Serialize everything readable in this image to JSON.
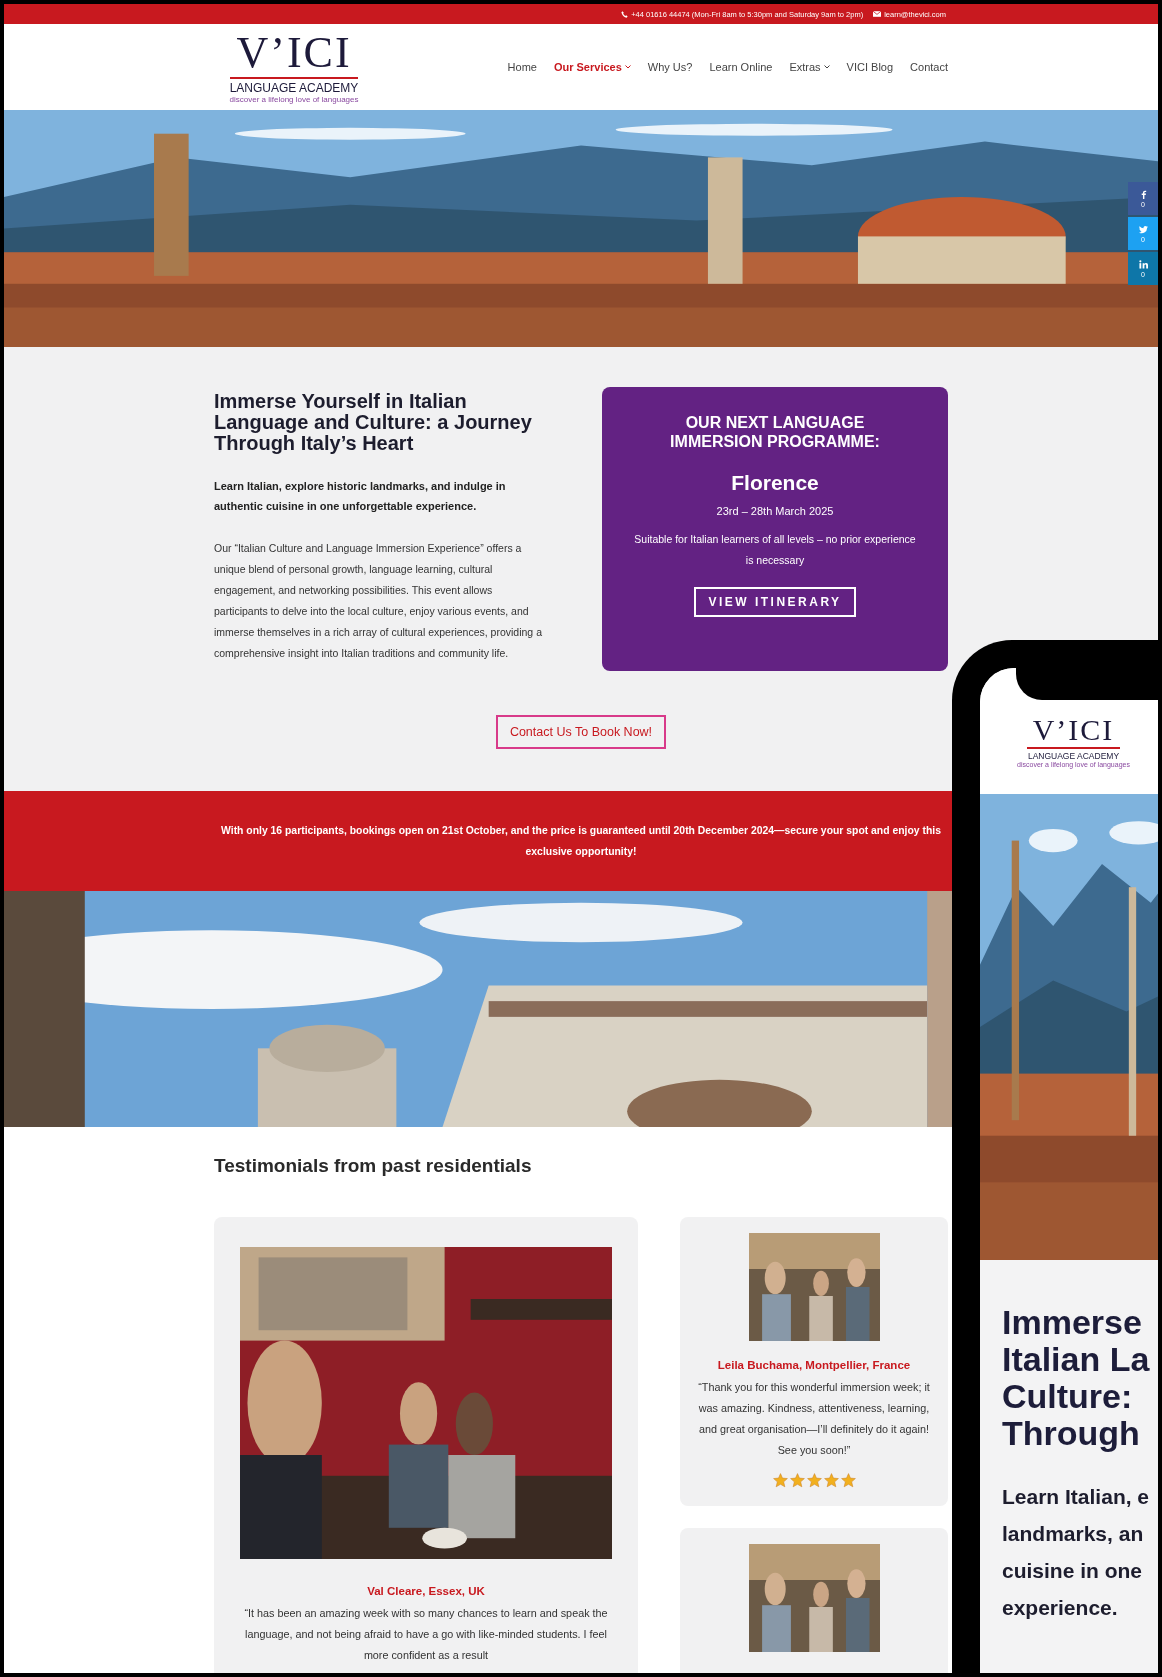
{
  "top_bar": {
    "phone": "+44 01616 44474 (Mon-Fri 8am to 5:30pm and Saturday 9am to 2pm)",
    "email": "learn@thevici.com"
  },
  "logo": {
    "name": "V’ICI",
    "subtitle": "LANGUAGE ACADEMY",
    "tagline": "discover a lifelong love of languages"
  },
  "nav": [
    {
      "label": "Home",
      "selected": false,
      "dropdown": false
    },
    {
      "label": "Our Services",
      "selected": true,
      "dropdown": true
    },
    {
      "label": "Why Us?",
      "selected": false,
      "dropdown": false
    },
    {
      "label": "Learn Online",
      "selected": false,
      "dropdown": false
    },
    {
      "label": "Extras",
      "selected": false,
      "dropdown": true
    },
    {
      "label": "VICI Blog",
      "selected": false,
      "dropdown": false
    },
    {
      "label": "Contact",
      "selected": false,
      "dropdown": false
    }
  ],
  "social": [
    {
      "kind": "facebook",
      "count": "0"
    },
    {
      "kind": "twitter",
      "count": "0"
    },
    {
      "kind": "linkedin",
      "count": "0"
    }
  ],
  "intro": {
    "heading": "Immerse Yourself in Italian Language and Culture: a Journey Through Italy’s Heart",
    "lead": "Learn Italian, explore historic landmarks, and indulge in authentic cuisine in one unforgettable experience.",
    "body": "Our “Italian Culture and Language Immersion Experience” offers a unique blend of personal growth, language learning, cultural engagement, and networking possibilities. This event allows participants to delve into the local culture, enjoy various events, and immerse themselves in a rich array of cultural experiences, providing a comprehensive insight into Italian traditions and community life."
  },
  "programme_card": {
    "title": "OUR NEXT LANGUAGE IMMERSION PROGRAMME:",
    "city": "Florence",
    "dates": "23rd – 28th March 2025",
    "note": "Suitable for Italian learners of all levels – no prior experience is necessary",
    "button": "VIEW ITINERARY"
  },
  "contact_button": "Contact Us To Book Now!",
  "banner": "With only 16 participants, bookings open on 21st October, and the price is guaranteed until 20th December 2024—secure your spot and enjoy this exclusive opportunity!",
  "testimonials_heading": "Testimonials from past residentials",
  "testimonials": [
    {
      "name": "Val Cleare, Essex, UK",
      "quote": "“It has been an amazing week with so many chances to learn and speak the language, and not being afraid to have a go with like-minded students. I feel more confident as a result"
    },
    {
      "name": "Leila Buchama, Montpellier, France",
      "quote": "“Thank you for this wonderful immersion week; it was amazing. Kindness, attentiveness, learning, and great organisation—I’ll definitely do it again! See you soon!”",
      "stars": 5
    }
  ],
  "phone_preview": {
    "logo": {
      "name": "V’ICI",
      "subtitle": "LANGUAGE ACADEMY",
      "tagline": "discover a lifelong love of languages"
    },
    "heading_lines": [
      "Immerse",
      "Italian La",
      "Culture:",
      "Through"
    ],
    "lead_lines": [
      "Learn Italian, e",
      "landmarks, an",
      "cuisine in one",
      "experience."
    ]
  }
}
